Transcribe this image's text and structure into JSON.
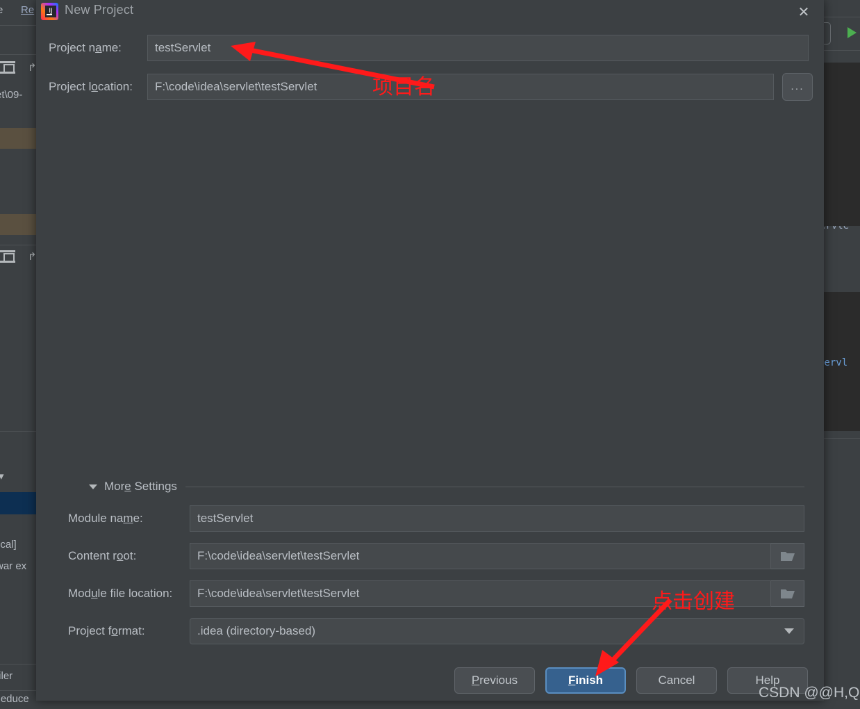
{
  "dialog": {
    "title": "New Project",
    "logo_icon": "intellij-idea-logo",
    "close_icon": "close-icon",
    "fields": [
      {
        "label_pre": "Project n",
        "label_accel": "a",
        "label_post": "me:",
        "value": "testServlet",
        "name": "project-name"
      },
      {
        "label_pre": "Project l",
        "label_accel": "o",
        "label_post": "cation:",
        "value": "F:\\code\\idea\\servlet\\testServlet",
        "name": "project-location"
      }
    ],
    "browse_button_label": "...",
    "more_settings": {
      "label_pre": "Mor",
      "label_accel": "e",
      "label_post": " Settings",
      "expand_icon": "triangle-down-icon",
      "fields": [
        {
          "label_pre": "Module na",
          "label_accel": "m",
          "label_post": "e:",
          "value": "testServlet",
          "name": "module-name",
          "has_folder": false
        },
        {
          "label_pre": "Content r",
          "label_accel": "o",
          "label_post": "ot:",
          "value": "F:\\code\\idea\\servlet\\testServlet",
          "name": "content-root",
          "has_folder": true
        },
        {
          "label_pre": "Mod",
          "label_accel": "u",
          "label_post": "le file location:",
          "value": "F:\\code\\idea\\servlet\\testServlet",
          "name": "module-file-location",
          "has_folder": true
        }
      ],
      "project_format": {
        "label_pre": "Project f",
        "label_accel": "o",
        "label_post": "rmat:",
        "value": ".idea (directory-based)",
        "caret_icon": "chevron-down-icon"
      }
    },
    "buttons": [
      {
        "label_pre": "",
        "label_accel": "P",
        "label_post": "revious",
        "name": "previous-button",
        "primary": false
      },
      {
        "label_pre": "",
        "label_accel": "F",
        "label_post": "inish",
        "name": "finish-button",
        "primary": true
      },
      {
        "label_pre": "Cancel",
        "label_accel": "",
        "label_post": "",
        "name": "cancel-button",
        "primary": false
      },
      {
        "label_pre": "Help",
        "label_accel": "",
        "label_post": "",
        "name": "help-button",
        "primary": false
      }
    ]
  },
  "annotations": {
    "accent_color": "#ff1a1a",
    "project_name_note": "项目名",
    "finish_note": "点击创建"
  },
  "watermark": {
    "text": "CSDN @@H,Q"
  },
  "background_ide": {
    "menu_left": "e",
    "menu_link": "Re",
    "path_fragment": "et\\09-",
    "left_items": [
      "ocal]",
      "war ex",
      "filer",
      "Reduce"
    ],
    "right_code_1": "ervle",
    "right_code_2": "Servl",
    "run_icon": "run-arrow-icon",
    "toolbar_icon": "expand-all-icon",
    "collapse_icon": "collapse-icon"
  }
}
